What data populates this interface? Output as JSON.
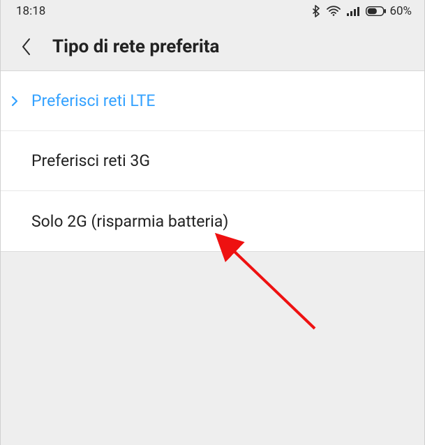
{
  "status_bar": {
    "time": "18:18",
    "battery_pct": "60%"
  },
  "header": {
    "title": "Tipo di rete preferita"
  },
  "options": [
    {
      "label": "Preferisci reti LTE",
      "selected": true
    },
    {
      "label": "Preferisci reti 3G",
      "selected": false
    },
    {
      "label": "Solo 2G (risparmia batteria)",
      "selected": false
    }
  ]
}
